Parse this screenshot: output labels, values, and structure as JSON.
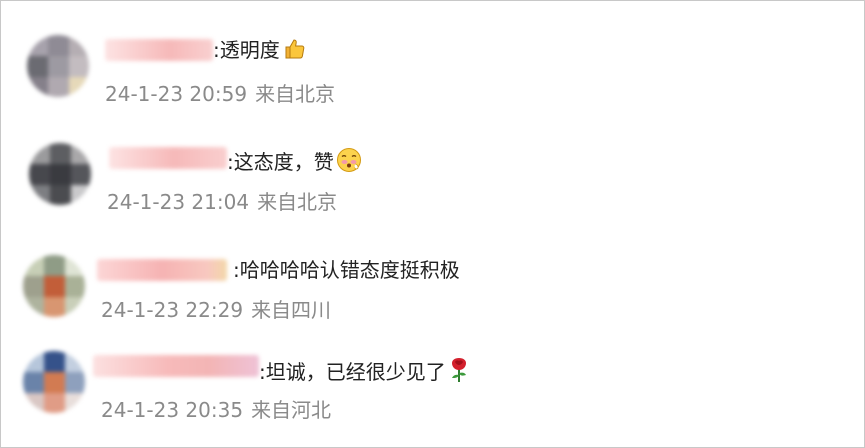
{
  "comments": [
    {
      "text": ":透明度",
      "time": "24-1-23 20:59",
      "source": "来自北京",
      "emoji": "thumbs-up-icon"
    },
    {
      "text": ":这态度，赞",
      "time": "24-1-23 21:04",
      "source": "来自北京",
      "emoji": "flushed-face-icon"
    },
    {
      "text": ":哈哈哈哈认错态度挺积极",
      "time": "24-1-23 22:29",
      "source": "来自四川",
      "emoji": ""
    },
    {
      "text": ":坦诚，已经很少见了",
      "time": "24-1-23 20:35",
      "source": "来自河北",
      "emoji": "rose-icon"
    }
  ],
  "colors": {
    "text": "#222222",
    "meta": "#8a8a8a",
    "blur_name": "#f4b6b6"
  }
}
